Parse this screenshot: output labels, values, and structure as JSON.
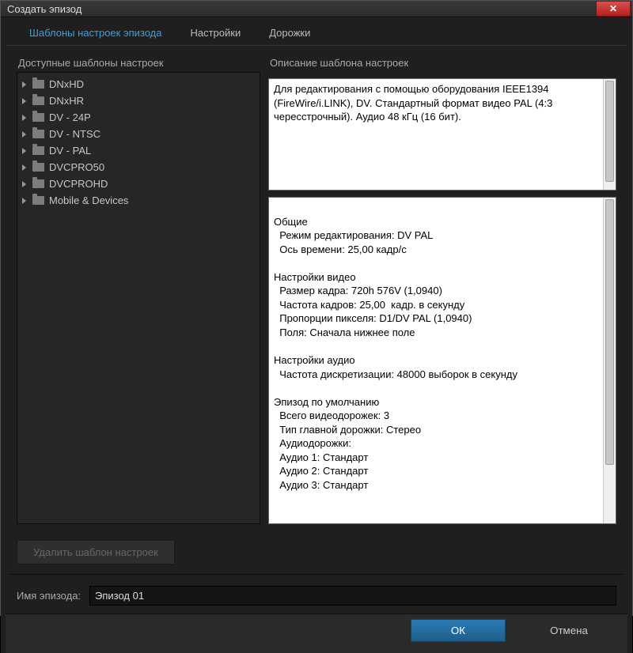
{
  "window": {
    "title": "Создать эпизод"
  },
  "tabs": [
    {
      "label": "Шаблоны настроек эпизода",
      "active": true
    },
    {
      "label": "Настройки",
      "active": false
    },
    {
      "label": "Дорожки",
      "active": false
    }
  ],
  "left": {
    "label": "Доступные шаблоны настроек",
    "items": [
      {
        "label": "DNxHD"
      },
      {
        "label": "DNxHR"
      },
      {
        "label": "DV - 24P"
      },
      {
        "label": "DV - NTSC"
      },
      {
        "label": "DV - PAL"
      },
      {
        "label": "DVCPRO50"
      },
      {
        "label": "DVCPROHD"
      },
      {
        "label": "Mobile & Devices"
      }
    ]
  },
  "right": {
    "label": "Описание шаблона настроек",
    "description": "Для редактирования с помощью оборудования IEEE1394 (FireWire/i.LINK), DV. Стандартный формат видео PAL (4:3 чересстрочный). Аудио 48 кГц (16 бит).",
    "details": "Общие\n  Режим редактирования: DV PAL\n  Ось времени: 25,00 кадр/с\n\nНастройки видео\n  Размер кадра: 720h 576V (1,0940)\n  Частота кадров: 25,00  кадр. в секунду\n  Пропорции пикселя: D1/DV PAL (1,0940)\n  Поля: Сначала нижнее поле\n\nНастройки аудио\n  Частота дискретизации: 48000 выборок в секунду\n\nЭпизод по умолчанию\n  Всего видеодорожек: 3\n  Тип главной дорожки: Стерео\n  Аудиодорожки:\n  Аудио 1: Стандарт\n  Аудио 2: Стандарт\n  Аудио 3: Стандарт"
  },
  "deleteBtn": "Удалить шаблон настроек",
  "name": {
    "label": "Имя эпизода:",
    "value": "Эпизод 01"
  },
  "buttons": {
    "ok": "ОК",
    "cancel": "Отмена"
  }
}
